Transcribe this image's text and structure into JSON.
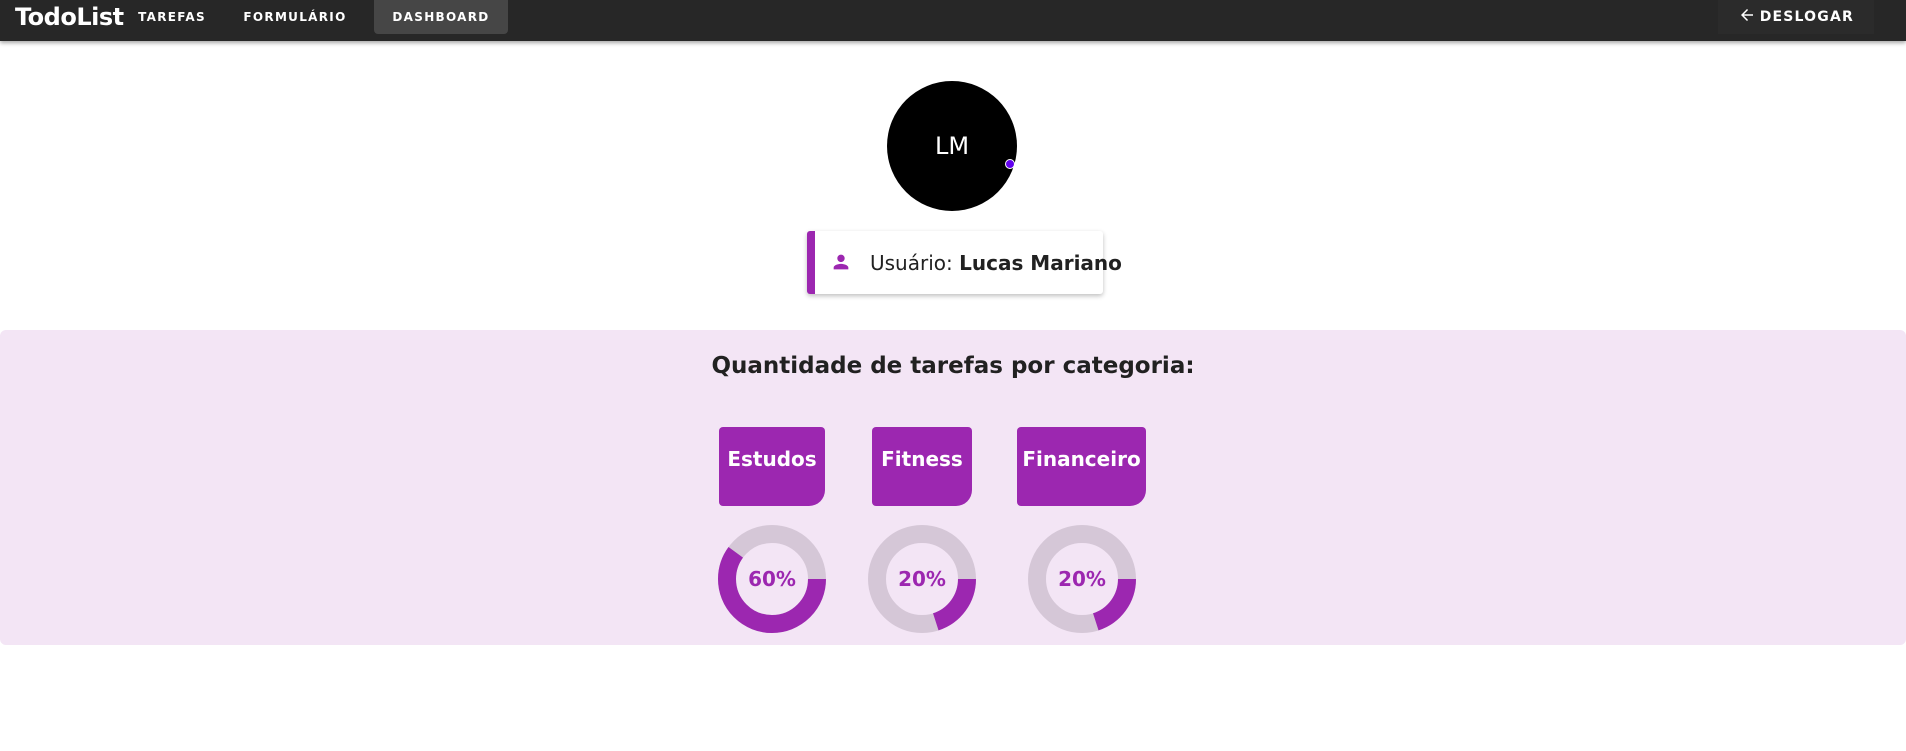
{
  "app": {
    "title": "TodoList"
  },
  "nav": {
    "tabs": [
      {
        "label": "TAREFAS"
      },
      {
        "label": "FORMULÁRIO"
      },
      {
        "label": "DASHBOARD",
        "active": true
      }
    ],
    "logout_label": "DESLOGAR"
  },
  "user": {
    "initials": "LM",
    "label_prefix": "Usuário:",
    "name": "Lucas Mariano"
  },
  "dashboard": {
    "title": "Quantidade de tarefas por categoria:",
    "categories": [
      {
        "label": "Estudos",
        "percent": 60,
        "percent_label": "60%"
      },
      {
        "label": "Fitness",
        "percent": 20,
        "percent_label": "20%"
      },
      {
        "label": "Financeiro",
        "percent": 20,
        "percent_label": "20%"
      }
    ]
  },
  "colors": {
    "accent": "#9c27b0",
    "track": "#d5c7d7",
    "panel_bg": "#f3e5f5",
    "topbar_bg": "#272727"
  },
  "icons": {
    "logout": "arrow-left-icon",
    "user": "person-icon"
  }
}
